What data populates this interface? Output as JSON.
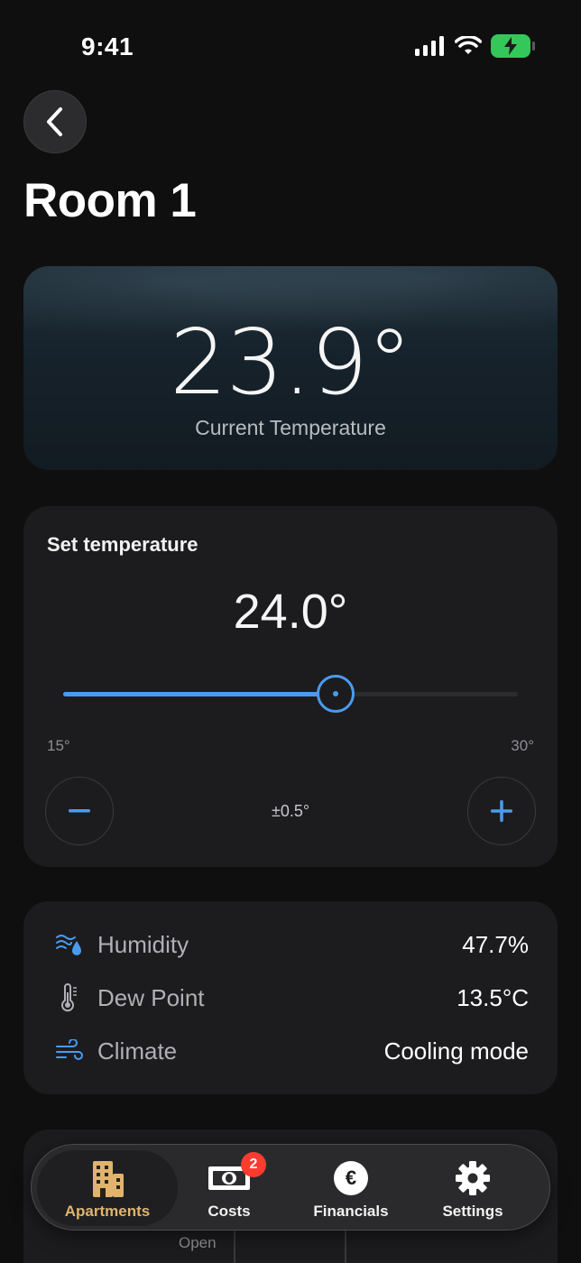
{
  "status_bar": {
    "time": "9:41"
  },
  "header": {
    "title": "Room 1"
  },
  "current": {
    "value": "23.9°",
    "label": "Current Temperature"
  },
  "setpoint": {
    "title": "Set temperature",
    "value": "24.0°",
    "min_label": "15°",
    "max_label": "30°",
    "slider_fraction": 0.6,
    "step_label": "±0.5°"
  },
  "info": {
    "rows": [
      {
        "label": "Humidity",
        "value": "47.7%",
        "icon": "humidity-icon"
      },
      {
        "label": "Dew Point",
        "value": "13.5°C",
        "icon": "thermometer-icon"
      },
      {
        "label": "Climate",
        "value": "Cooling mode",
        "icon": "wind-icon"
      }
    ]
  },
  "partial": {
    "label": "Open"
  },
  "tabs": [
    {
      "label": "Apartments",
      "icon": "building-icon",
      "active": true
    },
    {
      "label": "Costs",
      "icon": "banknote-icon",
      "badge": "2"
    },
    {
      "label": "Financials",
      "icon": "euro-icon",
      "symbol": "€"
    },
    {
      "label": "Settings",
      "icon": "gear-icon"
    }
  ],
  "colors": {
    "accent": "#4a9bf0",
    "active_tab": "#e0b46e",
    "badge": "#ff3b30",
    "battery": "#34c759"
  }
}
